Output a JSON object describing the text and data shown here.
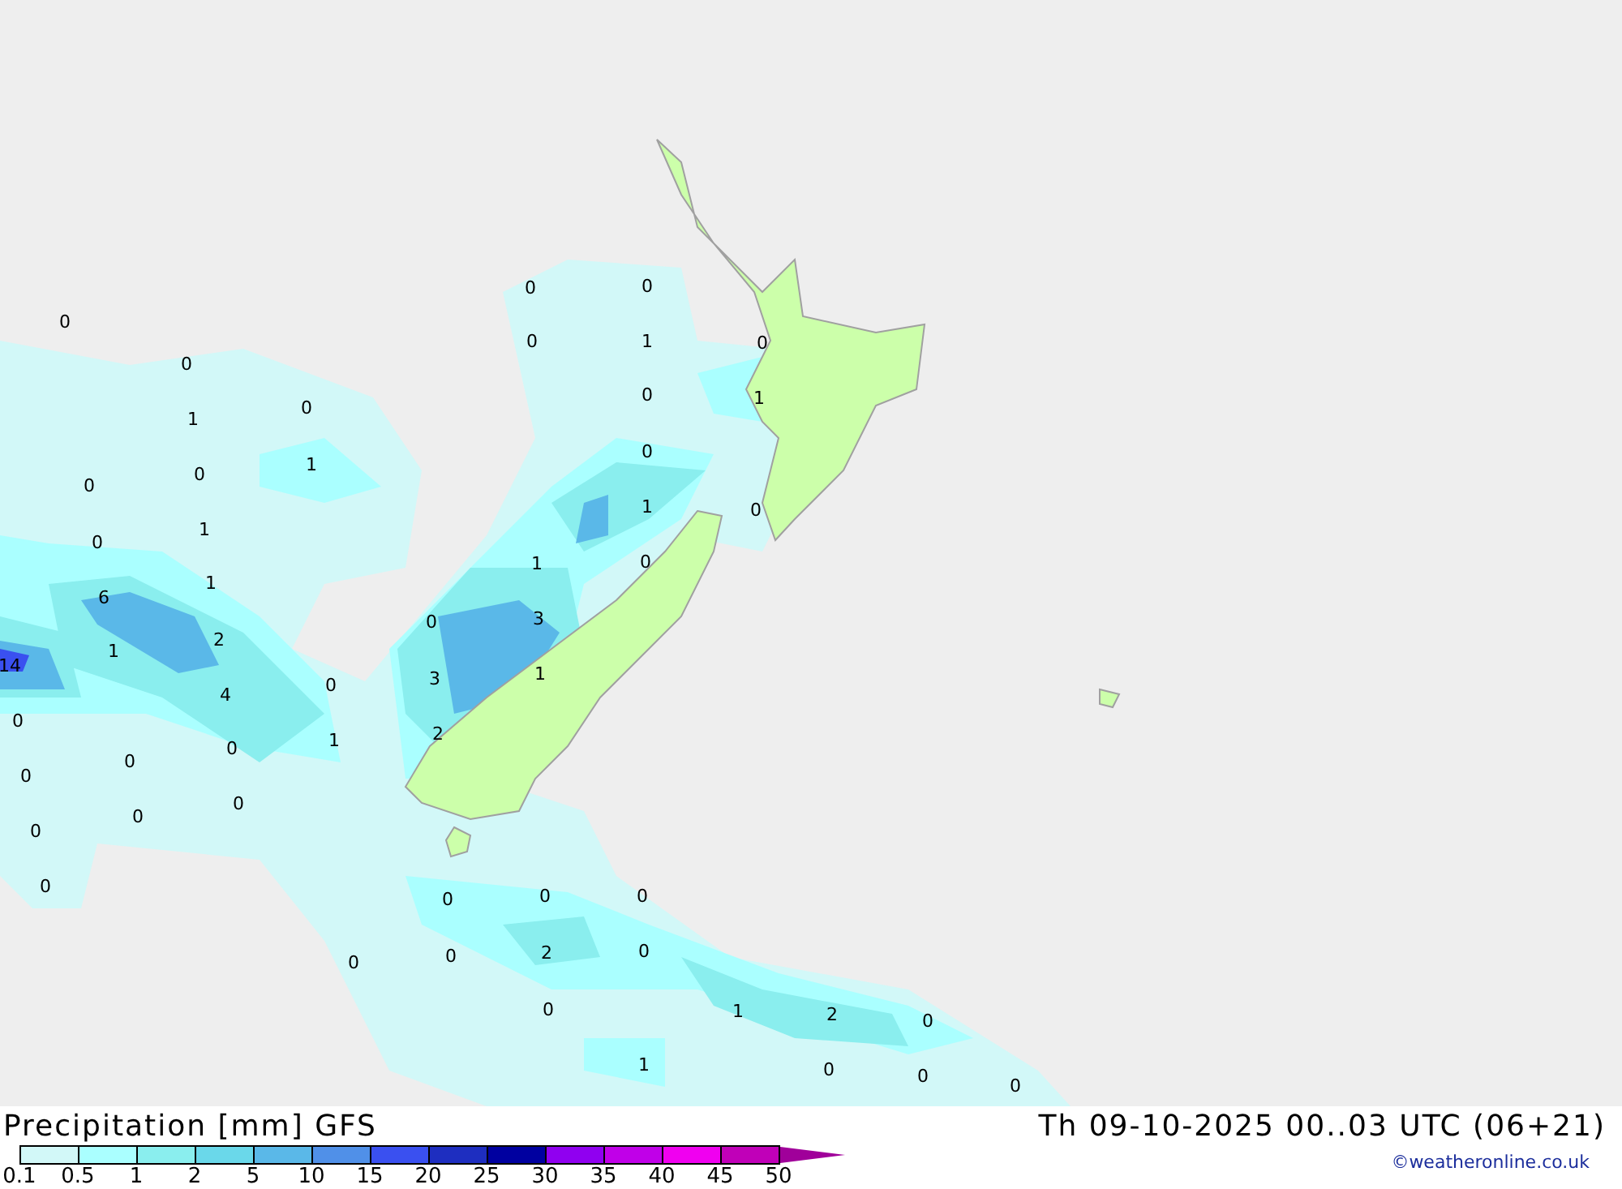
{
  "map": {
    "value_labels": [
      "0",
      "0",
      "1",
      "0",
      "1",
      "0",
      "0",
      "1",
      "0",
      "1",
      "6",
      "2",
      "1",
      "14",
      "4",
      "0",
      "0",
      "0",
      "1",
      "0",
      "0",
      "0",
      "0",
      "0",
      "0",
      "0",
      "0",
      "0",
      "1",
      "0",
      "0",
      "1",
      "0",
      "1",
      "0",
      "1",
      "0",
      "0",
      "3",
      "3",
      "1",
      "2",
      "0",
      "0",
      "0",
      "0",
      "0",
      "2",
      "0",
      "0",
      "1",
      "2",
      "0",
      "1",
      "0",
      "0",
      "0"
    ]
  },
  "footer": {
    "title": "Precipitation [mm] GFS",
    "valid_time": "Th 09-10-2025 00..03 UTC (06+21)",
    "credit": "©weatheronline.co.uk"
  },
  "legend": {
    "bins": [
      {
        "color": "#d2f8f8"
      },
      {
        "color": "#aaffff"
      },
      {
        "color": "#8aeeee"
      },
      {
        "color": "#6ad8ea"
      },
      {
        "color": "#5ab8e8"
      },
      {
        "color": "#5090e8"
      },
      {
        "color": "#3a50f0"
      },
      {
        "color": "#1e2ec0"
      },
      {
        "color": "#0000a0"
      },
      {
        "color": "#9000f0"
      },
      {
        "color": "#c000e8"
      },
      {
        "color": "#f000f0"
      },
      {
        "color": "#c000b8"
      },
      {
        "color": "#a0009a",
        "kind": "arrow"
      }
    ],
    "ticks": [
      "0.1",
      "0.5",
      "1",
      "2",
      "5",
      "10",
      "15",
      "20",
      "25",
      "30",
      "35",
      "40",
      "45",
      "50"
    ]
  }
}
